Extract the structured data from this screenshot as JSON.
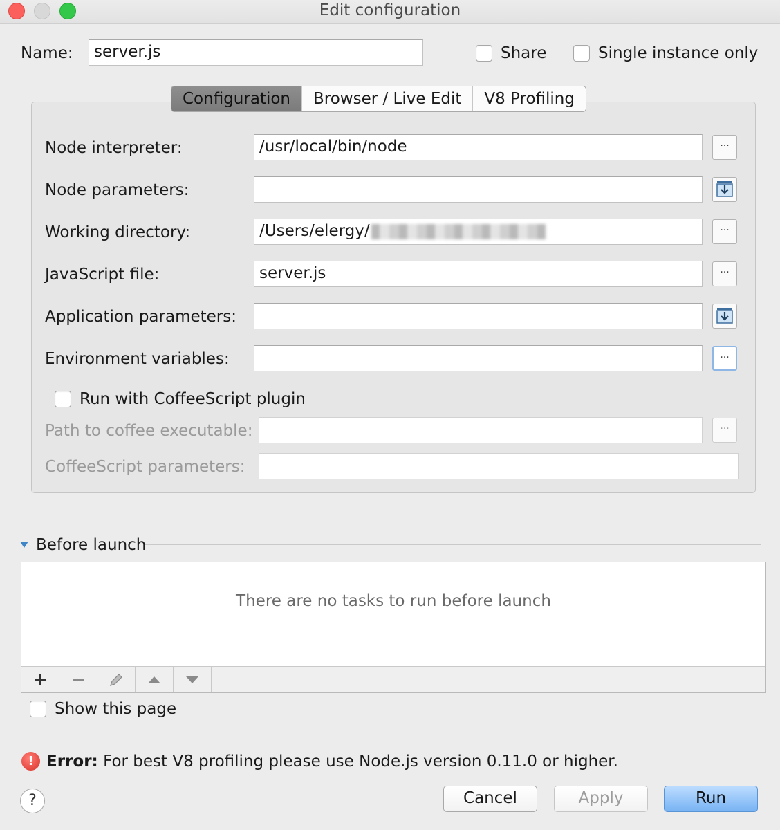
{
  "window": {
    "title": "Edit configuration"
  },
  "header": {
    "name_label": "Name:",
    "name_value": "server.js",
    "share_label": "Share",
    "single_instance_label": "Single instance only"
  },
  "tabs": [
    {
      "label": "Configuration",
      "active": true
    },
    {
      "label": "Browser / Live Edit",
      "active": false
    },
    {
      "label": "V8 Profiling",
      "active": false
    }
  ],
  "form": {
    "node_interpreter": {
      "label": "Node interpreter:",
      "value": "/usr/local/bin/node"
    },
    "node_parameters": {
      "label": "Node parameters:",
      "value": ""
    },
    "working_directory": {
      "label": "Working directory:",
      "value": "/Users/elergy/"
    },
    "javascript_file": {
      "label": "JavaScript file:",
      "value": "server.js"
    },
    "application_parameters": {
      "label": "Application parameters:",
      "value": ""
    },
    "environment_variables": {
      "label": "Environment variables:",
      "value": ""
    },
    "coffeescript_checkbox": "Run with CoffeeScript plugin",
    "coffee_path": {
      "label": "Path to coffee executable:",
      "value": ""
    },
    "coffee_params": {
      "label": "CoffeeScript parameters:",
      "value": ""
    },
    "browse_glyph": "···"
  },
  "before_launch": {
    "title": "Before launch",
    "empty_text": "There are no tasks to run before launch",
    "show_page_label": "Show this page"
  },
  "error": {
    "prefix": "Error:",
    "message": "For best V8 profiling please use Node.js version 0.11.0 or higher.",
    "icon_glyph": "!"
  },
  "footer": {
    "help_glyph": "?",
    "cancel_label": "Cancel",
    "apply_label": "Apply",
    "run_label": "Run"
  },
  "colors": {
    "run_button": "#77b3f3",
    "error_icon": "#d9322a",
    "accent": "#3d85c6"
  }
}
